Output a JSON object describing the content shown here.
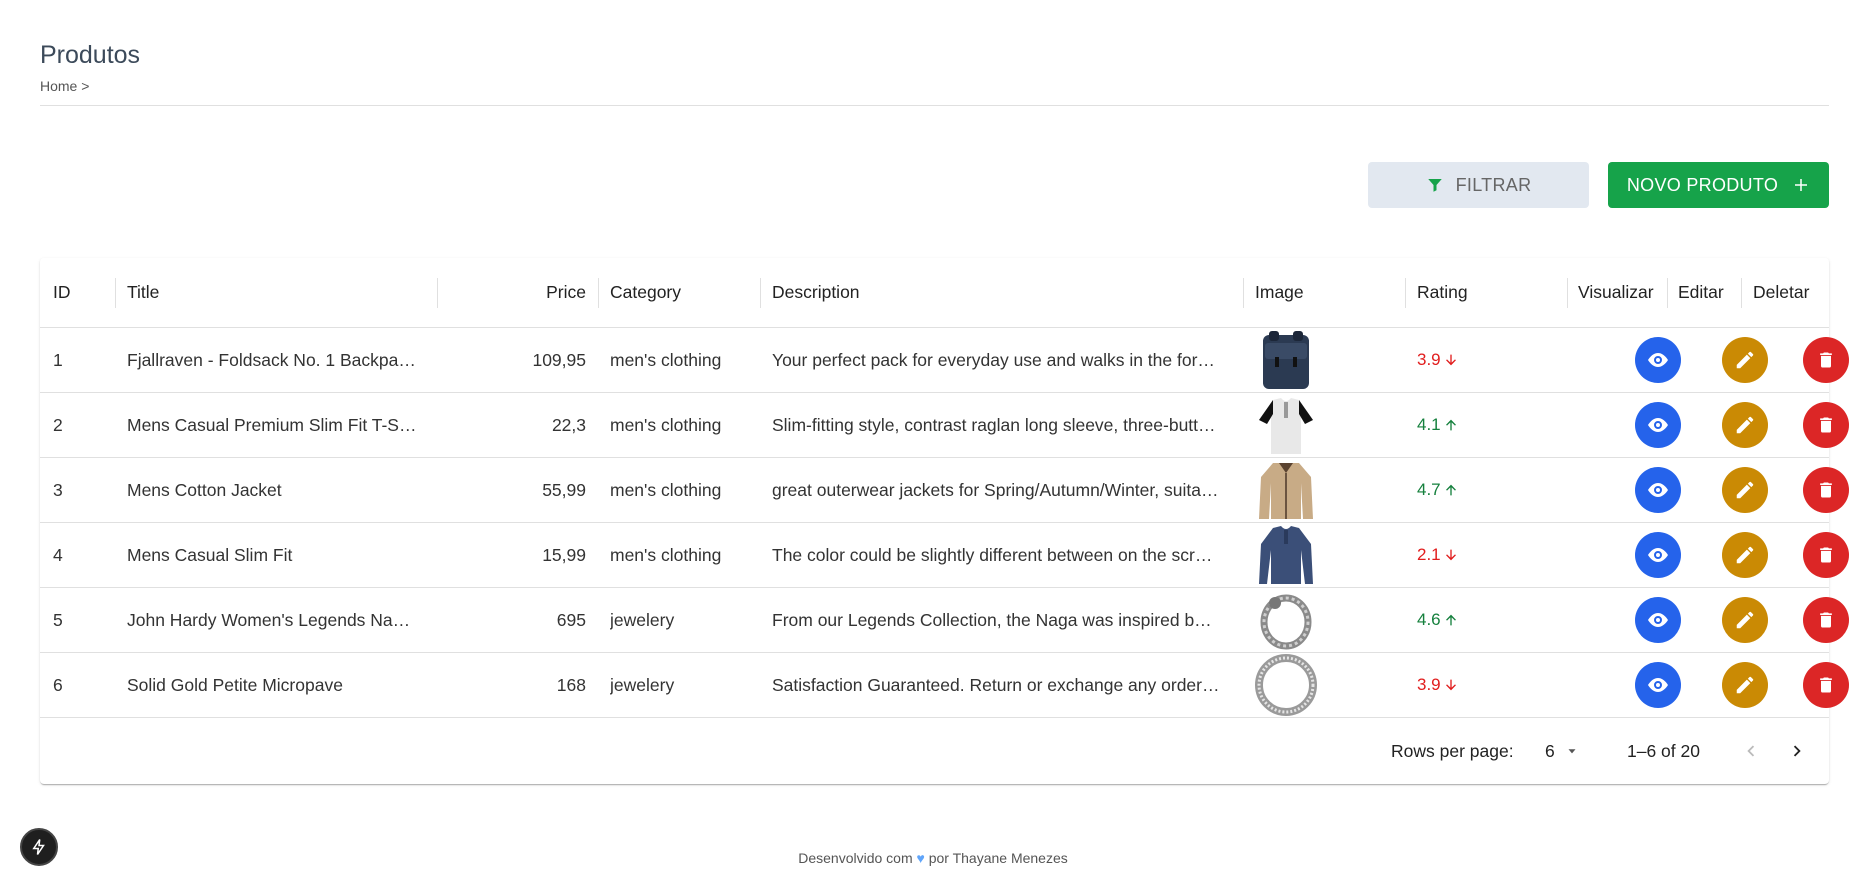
{
  "header": {
    "title": "Produtos",
    "breadcrumb": "Home >"
  },
  "actions": {
    "filter_label": "FILTRAR",
    "new_label": "NOVO PRODUTO"
  },
  "table": {
    "columns": [
      "ID",
      "Title",
      "Price",
      "Category",
      "Description",
      "Image",
      "Rating",
      "Visualizar",
      "Editar",
      "Deletar"
    ],
    "rows": [
      {
        "id": "1",
        "title": "Fjallraven - Foldsack No. 1 Backpa…",
        "price": "109,95",
        "category": "men's clothing",
        "description": "Your perfect pack for everyday use and walks in the for…",
        "image": "backpack",
        "rating": "3.9",
        "trend": "down"
      },
      {
        "id": "2",
        "title": "Mens Casual Premium Slim Fit T-S…",
        "price": "22,3",
        "category": "men's clothing",
        "description": "Slim-fitting style, contrast raglan long sleeve, three-butt…",
        "image": "tshirt",
        "rating": "4.1",
        "trend": "up"
      },
      {
        "id": "3",
        "title": "Mens Cotton Jacket",
        "price": "55,99",
        "category": "men's clothing",
        "description": "great outerwear jackets for Spring/Autumn/Winter, suita…",
        "image": "jacket",
        "rating": "4.7",
        "trend": "up"
      },
      {
        "id": "4",
        "title": "Mens Casual Slim Fit",
        "price": "15,99",
        "category": "men's clothing",
        "description": "The color could be slightly different between on the scr…",
        "image": "longsleeve",
        "rating": "2.1",
        "trend": "down"
      },
      {
        "id": "5",
        "title": "John Hardy Women's Legends Na…",
        "price": "695",
        "category": "jewelery",
        "description": "From our Legends Collection, the Naga was inspired b…",
        "image": "bracelet",
        "rating": "4.6",
        "trend": "up"
      },
      {
        "id": "6",
        "title": "Solid Gold Petite Micropave",
        "price": "168",
        "category": "jewelery",
        "description": "Satisfaction Guaranteed. Return or exchange any order…",
        "image": "ring",
        "rating": "3.9",
        "trend": "down"
      }
    ]
  },
  "pagination": {
    "rows_per_page_label": "Rows per page:",
    "rows_per_page": "6",
    "range": "1–6 of 20"
  },
  "footer": {
    "text_before": "Desenvolvido com",
    "text_after": "por Thayane Menezes"
  },
  "colors": {
    "view": "#2563eb",
    "edit": "#ca8a04",
    "delete": "#dc2626",
    "primary": "#16a34a",
    "rating_up": "#15803d",
    "rating_down": "#e11d1d"
  }
}
